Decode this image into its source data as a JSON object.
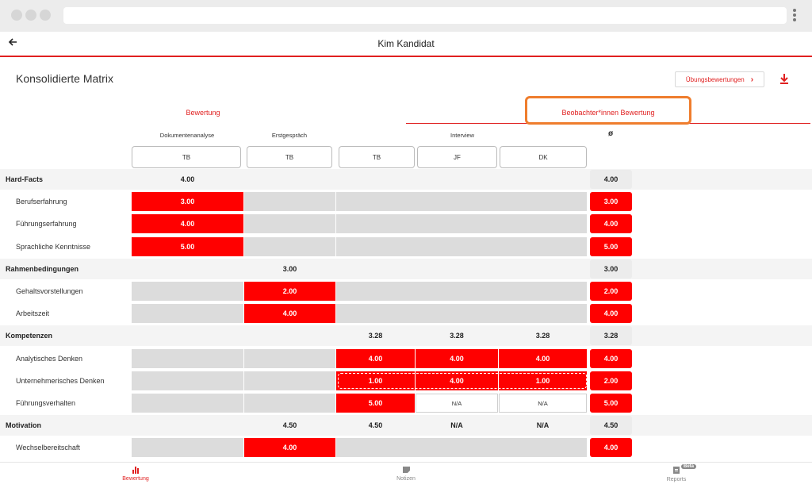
{
  "app": {
    "title": "Kim Kandidat"
  },
  "page": {
    "title": "Konsolidierte Matrix",
    "ubungs_button": "Übungsbewertungen"
  },
  "tabs": [
    {
      "label": "Bewertung"
    },
    {
      "label": "Beobachter*innen Bewertung"
    }
  ],
  "columns": {
    "dokumentenanalyse": "Dokumentenanalyse",
    "erstgespraech": "Erstgespräch",
    "interview": "Interview",
    "avg": "ø"
  },
  "observers": [
    "TB",
    "TB",
    "TB",
    "JF",
    "DK"
  ],
  "rows": [
    {
      "label": "Hard-Facts",
      "type": "group",
      "cells": [
        "4.00",
        "",
        "",
        "",
        ""
      ],
      "avg": "4.00"
    },
    {
      "label": "Berufserfahrung",
      "type": "sub",
      "cells": [
        "3.00",
        "",
        "",
        "",
        ""
      ],
      "avg": "3.00"
    },
    {
      "label": "Führungserfahrung",
      "type": "sub",
      "cells": [
        "4.00",
        "",
        "",
        "",
        ""
      ],
      "avg": "4.00"
    },
    {
      "label": "Sprachliche Kenntnisse",
      "type": "sub",
      "cells": [
        "5.00",
        "",
        "",
        "",
        ""
      ],
      "avg": "5.00"
    },
    {
      "label": "Rahmenbedingungen",
      "type": "group",
      "cells": [
        "",
        "3.00",
        "",
        "",
        ""
      ],
      "avg": "3.00"
    },
    {
      "label": "Gehaltsvorstellungen",
      "type": "sub",
      "cells": [
        "",
        "2.00",
        "",
        "",
        ""
      ],
      "avg": "2.00"
    },
    {
      "label": "Arbeitszeit",
      "type": "sub",
      "cells": [
        "",
        "4.00",
        "",
        "",
        ""
      ],
      "avg": "4.00"
    },
    {
      "label": "Kompetenzen",
      "type": "group",
      "cells": [
        "",
        "",
        "3.28",
        "3.28",
        "3.28"
      ],
      "avg": "3.28"
    },
    {
      "label": "Analytisches Denken",
      "type": "sub",
      "cells": [
        "",
        "",
        "4.00",
        "4.00",
        "4.00"
      ],
      "avg": "4.00"
    },
    {
      "label": "Unternehmerisches Denken",
      "type": "sub",
      "cells": [
        "",
        "",
        "1.00",
        "4.00",
        "1.00"
      ],
      "avg": "2.00"
    },
    {
      "label": "Führungsverhalten",
      "type": "sub",
      "cells": [
        "",
        "",
        "5.00",
        "N/A",
        "N/A"
      ],
      "avg": "5.00"
    },
    {
      "label": "Motivation",
      "type": "group",
      "cells": [
        "",
        "4.50",
        "4.50",
        "N/A",
        "N/A"
      ],
      "avg": "4.50"
    },
    {
      "label": "Wechselbereitschaft",
      "type": "sub",
      "cells": [
        "",
        "4.00",
        "",
        "",
        ""
      ],
      "avg": "4.00"
    }
  ],
  "bottom_nav": [
    {
      "label": "Bewertung",
      "icon": "bar-chart-icon",
      "active": true
    },
    {
      "label": "Notizen",
      "icon": "note-icon",
      "active": false
    },
    {
      "label": "Reports",
      "icon": "report-icon",
      "badge": "Beta",
      "active": false
    }
  ],
  "colors": {
    "accent": "#ff0000",
    "highlight": "#ef7d2d"
  }
}
